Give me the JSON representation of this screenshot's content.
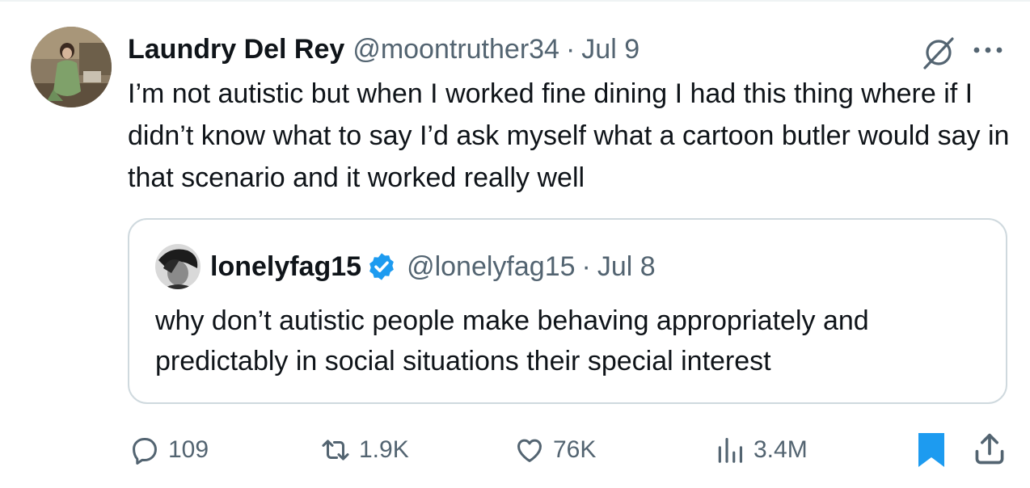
{
  "tweet": {
    "author_name": "Laundry Del Rey",
    "handle": "@moontruther34",
    "separator": "·",
    "date": "Jul 9",
    "text": "I’m not autistic but when I worked fine dining I had this thing where if I didn’t know what to say I’d ask myself what a cartoon butler would say in that scenario and it worked really well"
  },
  "quote": {
    "author_name": "lonelyfag15",
    "handle": "@lonelyfag15",
    "separator": "·",
    "date": "Jul 8",
    "text": "why don’t autistic people make behaving appropriately and predictably in social situations their special interest",
    "verified": true
  },
  "actions": {
    "replies": "109",
    "reposts": "1.9K",
    "likes": "76K",
    "views": "3.4M",
    "bookmarked": true
  },
  "icons": {
    "grok": "grok-icon",
    "more": "more-icon",
    "reply": "reply-icon",
    "repost": "repost-icon",
    "like": "heart-icon",
    "views": "views-icon",
    "bookmark": "bookmark-icon",
    "share": "share-icon",
    "verified": "verified-badge-icon"
  },
  "colors": {
    "text": "#0f1419",
    "secondary": "#536471",
    "accent": "#1d9bf0",
    "border": "#cfd9de"
  }
}
